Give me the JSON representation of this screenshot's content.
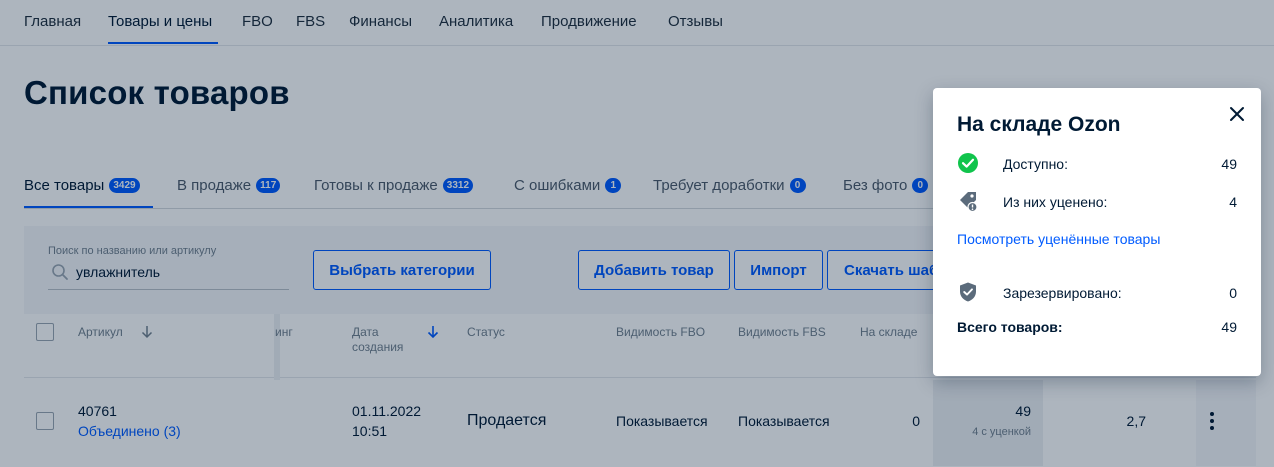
{
  "nav": {
    "items": [
      "Главная",
      "Товары и цены",
      "FBO",
      "FBS",
      "Финансы",
      "Аналитика",
      "Продвижение",
      "Отзывы"
    ],
    "active": "Товары и цены"
  },
  "page": {
    "title": "Список товаров"
  },
  "tabs": [
    {
      "label": "Все товары",
      "count": "3429"
    },
    {
      "label": "В продаже",
      "count": "117"
    },
    {
      "label": "Готовы к продаже",
      "count": "3312"
    },
    {
      "label": "С ошибками",
      "count": "1"
    },
    {
      "label": "Требует доработки",
      "count": "0"
    },
    {
      "label": "Без фото",
      "count": "0"
    }
  ],
  "toolbar": {
    "search_label": "Поиск по названию или артикулу",
    "search_value": "увлажнитель",
    "select_categories": "Выбрать категории",
    "add_product": "Добавить товар",
    "import": "Импорт",
    "download_template": "Скачать шаблон"
  },
  "table": {
    "headers": {
      "sku": "Артикул",
      "rating": "инг",
      "created": "Дата создания",
      "status": "Статус",
      "vis_fbo": "Видимость FBO",
      "vis_fbs": "Видимость FBS",
      "in_stock": "На складе"
    },
    "row": {
      "sku": "40761",
      "merged": "Объединено (3)",
      "created_date": "01.11.2022",
      "created_time": "10:51",
      "status": "Продается",
      "vis_fbo": "Показывается",
      "vis_fbs": "Показывается",
      "in_stock": "0",
      "ozon_stock": "49",
      "ozon_stock_note": "4 с уценкой",
      "rating_value": "2,7"
    }
  },
  "popover": {
    "title": "На складе Ozon",
    "available_label": "Доступно:",
    "available_value": "49",
    "discounted_label": "Из них уценено:",
    "discounted_value": "4",
    "link": "Посмотреть уценённые товары",
    "reserved_label": "Зарезервировано:",
    "reserved_value": "0",
    "total_label": "Всего товаров:",
    "total_value": "49"
  },
  "colors": {
    "accent": "#005bff",
    "success": "#10c44c",
    "text": "#001a34",
    "muted": "#707f8d"
  },
  "icons": [
    "search-icon",
    "arrow-down-icon",
    "check-circle-icon",
    "discount-tag-icon",
    "shield-icon",
    "close-icon",
    "more-vertical-icon"
  ]
}
